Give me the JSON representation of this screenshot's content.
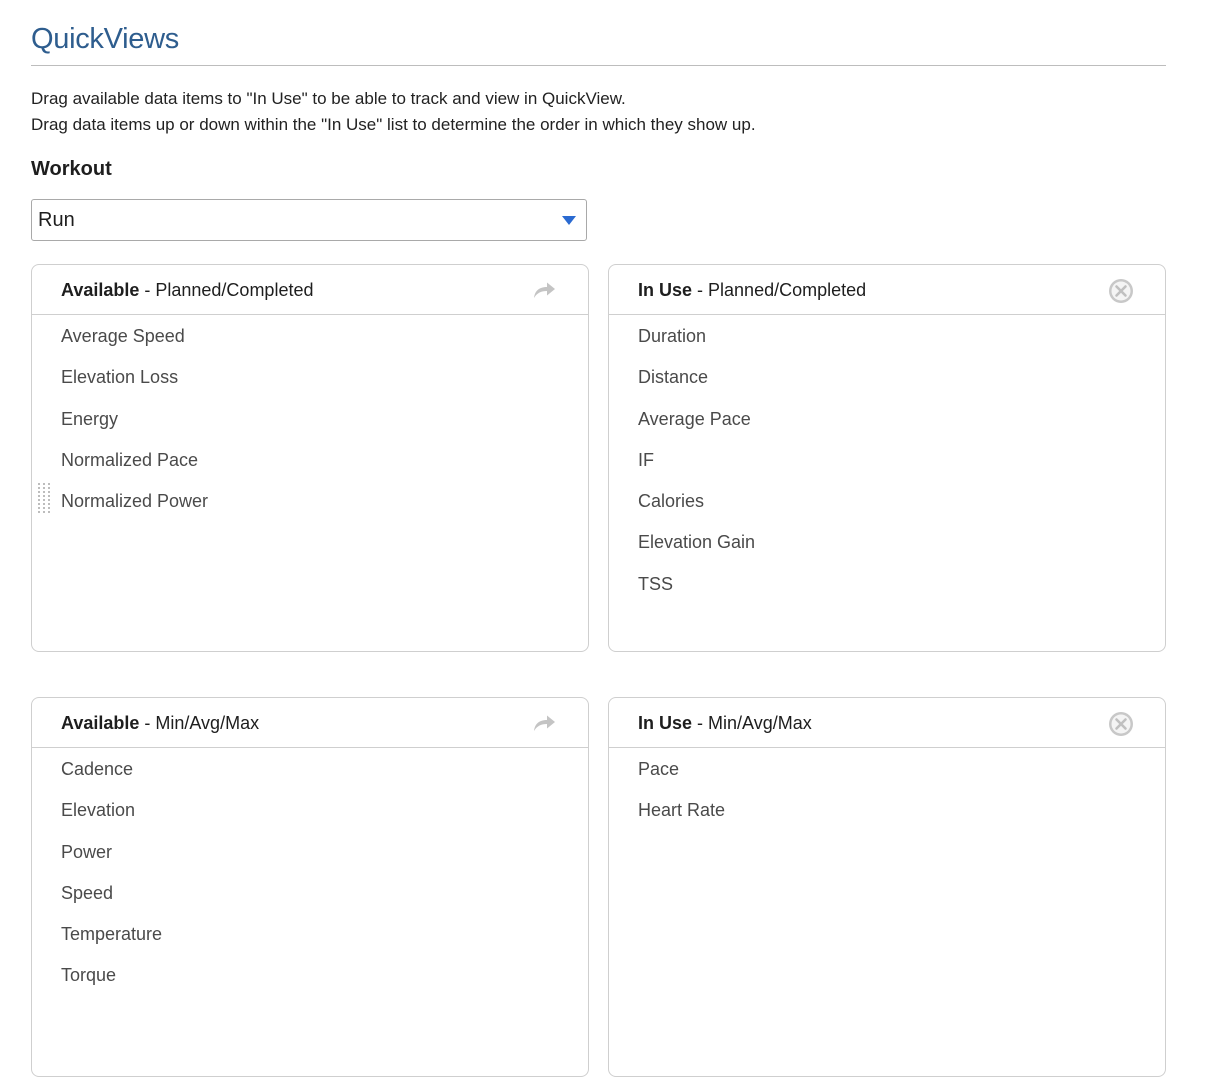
{
  "page": {
    "title": "QuickViews",
    "description_line1": "Drag available data items to \"In Use\" to be able to track and view in QuickView.",
    "description_line2": "Drag data items up or down within the \"In Use\" list to determine the order in which they show up."
  },
  "workout": {
    "label": "Workout",
    "selected": "Run"
  },
  "panels": {
    "available_planned": {
      "heading_strong": "Available",
      "heading_rest": " - Planned/Completed",
      "icon": "forward-arrow-icon",
      "items": [
        "Average Speed",
        "Elevation Loss",
        "Energy",
        "Normalized Pace",
        "Normalized Power"
      ]
    },
    "inuse_planned": {
      "heading_strong": "In Use",
      "heading_rest": " - Planned/Completed",
      "icon": "close-circle-icon",
      "items": [
        "Duration",
        "Distance",
        "Average Pace",
        "IF",
        "Calories",
        "Elevation Gain",
        "TSS"
      ]
    },
    "available_minavgmax": {
      "heading_strong": "Available",
      "heading_rest": " - Min/Avg/Max",
      "icon": "forward-arrow-icon",
      "items": [
        "Cadence",
        "Elevation",
        "Power",
        "Speed",
        "Temperature",
        "Torque"
      ]
    },
    "inuse_minavgmax": {
      "heading_strong": "In Use",
      "heading_rest": " - Min/Avg/Max",
      "icon": "close-circle-icon",
      "items": [
        "Pace",
        "Heart Rate"
      ]
    }
  },
  "colors": {
    "title": "#2e5d8e",
    "select_arrow": "#2a6ad1",
    "icon_gray": "#c4c4c4"
  }
}
